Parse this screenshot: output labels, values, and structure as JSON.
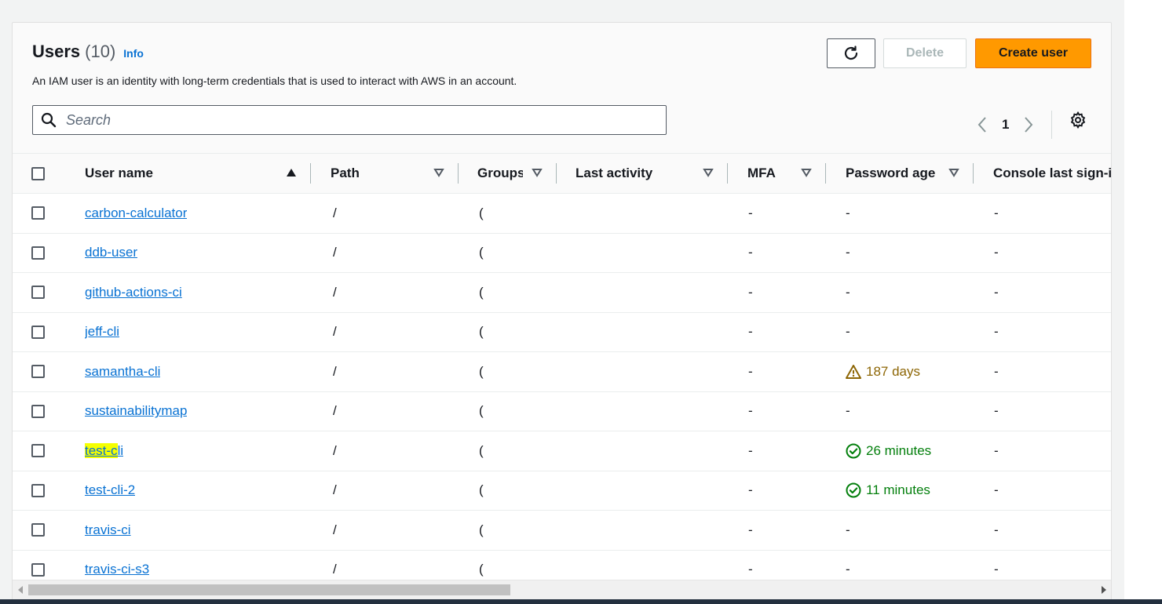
{
  "header": {
    "title": "Users",
    "count": "(10)",
    "info_link": "Info",
    "description": "An IAM user is an identity with long-term credentials that is used to interact with AWS in an account."
  },
  "toolbar": {
    "refresh_icon": "refresh-icon",
    "delete_label": "Delete",
    "create_label": "Create user"
  },
  "search": {
    "placeholder": "Search",
    "value": ""
  },
  "pagination": {
    "current_page": "1"
  },
  "table": {
    "columns": [
      "User name",
      "Path",
      "Groups",
      "Last activity",
      "MFA",
      "Password age",
      "Console last sign-in"
    ],
    "rows": [
      {
        "user": "carbon-calculator",
        "path": "/",
        "groups": "(",
        "last_activity": "",
        "mfa": "-",
        "password_age": "-",
        "console": "-",
        "status": "none"
      },
      {
        "user": "ddb-user",
        "path": "/",
        "groups": "(",
        "last_activity": "",
        "mfa": "-",
        "password_age": "-",
        "console": "-",
        "status": "none"
      },
      {
        "user": "github-actions-ci",
        "path": "/",
        "groups": "(",
        "last_activity": "",
        "mfa": "-",
        "password_age": "-",
        "console": "-",
        "status": "none"
      },
      {
        "user": "jeff-cli",
        "path": "/",
        "groups": "(",
        "last_activity": "",
        "mfa": "-",
        "password_age": "-",
        "console": "-",
        "status": "none"
      },
      {
        "user": "samantha-cli",
        "path": "/",
        "groups": "(",
        "last_activity": "",
        "mfa": "-",
        "password_age": "187 days",
        "console": "-",
        "status": "warning"
      },
      {
        "user": "sustainabilitymap",
        "path": "/",
        "groups": "(",
        "last_activity": "",
        "mfa": "-",
        "password_age": "-",
        "console": "-",
        "status": "none"
      },
      {
        "user": "test-cli",
        "path": "/",
        "groups": "(",
        "last_activity": "",
        "mfa": "-",
        "password_age": "26 minutes",
        "console": "-",
        "status": "ok",
        "highlight": "test-c"
      },
      {
        "user": "test-cli-2",
        "path": "/",
        "groups": "(",
        "last_activity": "",
        "mfa": "-",
        "password_age": "11 minutes",
        "console": "-",
        "status": "ok"
      },
      {
        "user": "travis-ci",
        "path": "/",
        "groups": "(",
        "last_activity": "",
        "mfa": "-",
        "password_age": "-",
        "console": "-",
        "status": "none"
      },
      {
        "user": "travis-ci-s3",
        "path": "/",
        "groups": "(",
        "last_activity": "",
        "mfa": "-",
        "password_age": "-",
        "console": "-",
        "status": "none"
      }
    ]
  },
  "colors": {
    "accent": "#0972d3",
    "primary_button": "#ff9900",
    "warning": "#8d6605",
    "success": "#037f0c",
    "highlight": "#f5ff00"
  },
  "icons": {
    "search": "search-icon",
    "settings": "gear-icon",
    "prev": "chevron-left-icon",
    "next": "chevron-right-icon",
    "warning": "warning-icon",
    "success": "check-circle-icon"
  }
}
